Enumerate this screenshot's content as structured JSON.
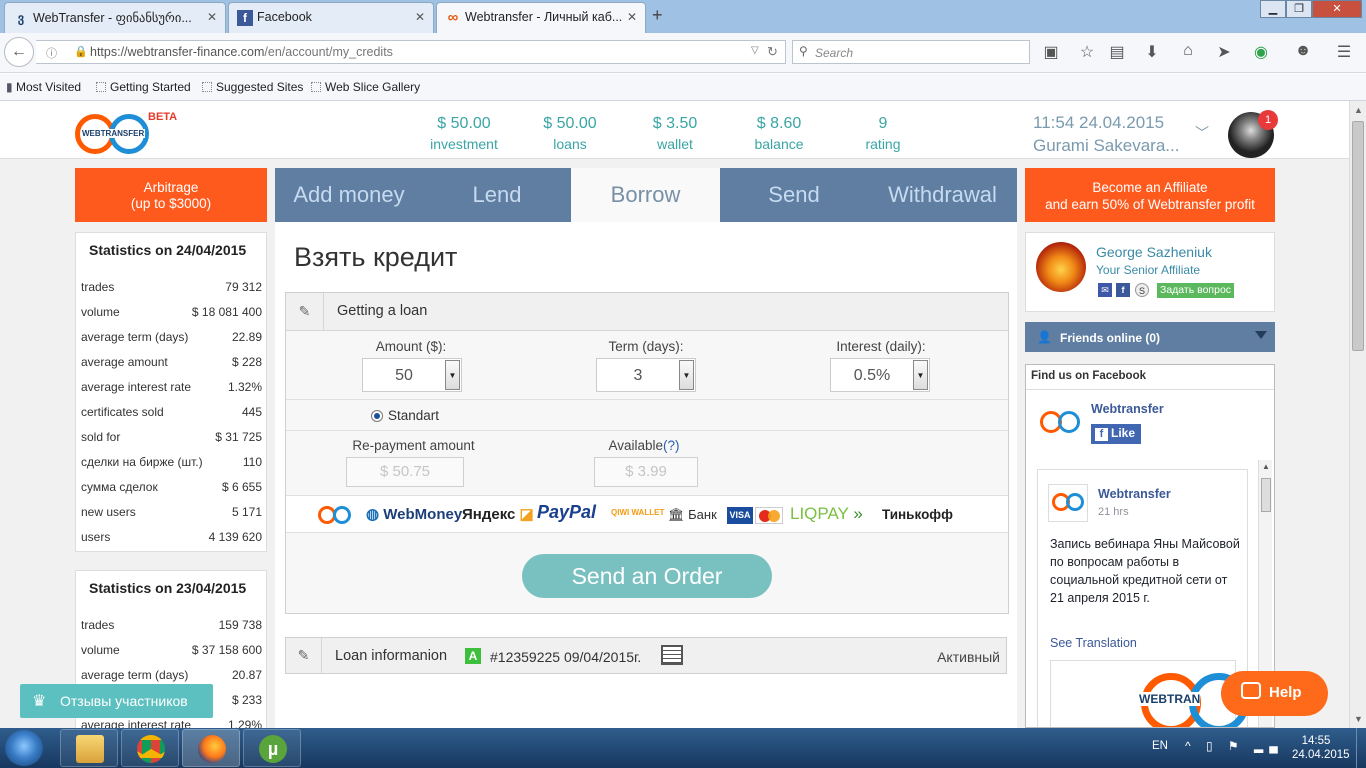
{
  "browser": {
    "tabs": [
      {
        "title": "WebTransfer - ფინანსური...",
        "favicon": "georgian-letter-icon",
        "fav_glyph": "ვ"
      },
      {
        "title": "Facebook",
        "favicon": "facebook-icon",
        "fav_glyph": "f"
      },
      {
        "title": "Webtransfer - Личный каб...",
        "favicon": "webtransfer-icon",
        "fav_glyph": "∞"
      }
    ],
    "close_glyph": "✕",
    "new_tab_glyph": "+",
    "url_domain": "https://webtransfer-finance.com",
    "url_path": "/en/account/my_credits",
    "search_placeholder": "Search",
    "bookmarks": [
      "Most Visited",
      "Getting Started",
      "Suggested Sites",
      "Web Slice Gallery"
    ]
  },
  "header": {
    "logo_text": "WEBTRANSFER",
    "beta": "BETA",
    "stats": [
      {
        "value": "$ 50.00",
        "label": "investment"
      },
      {
        "value": "$ 50.00",
        "label": "loans"
      },
      {
        "value": "$ 3.50",
        "label": "wallet"
      },
      {
        "value": "$ 8.60",
        "label": "balance"
      },
      {
        "value": "9",
        "label": "rating"
      }
    ],
    "datetime": "11:54 24.04.2015",
    "username": "Gurami Sakevara...",
    "notifications": "1"
  },
  "arbitrage": {
    "line1": "Arbitrage",
    "line2": "(up to $3000)"
  },
  "affiliate_promo": {
    "line1": "Become an Affiliate",
    "line2": "and earn 50% of Webtransfer profit"
  },
  "tabs": [
    "Add money",
    "Lend",
    "Borrow",
    "Send",
    "Withdrawal"
  ],
  "active_tab": "Borrow",
  "stats_today": {
    "title": "Statistics on 24/04/2015",
    "rows": [
      {
        "k": "trades",
        "v": "79 312"
      },
      {
        "k": "volume",
        "v": "$ 18 081 400"
      },
      {
        "k": "average term (days)",
        "v": "22.89"
      },
      {
        "k": "average amount",
        "v": "$ 228"
      },
      {
        "k": "average interest rate",
        "v": "1.32%"
      },
      {
        "k": "certificates sold",
        "v": "445"
      },
      {
        "k": "sold for",
        "v": "$ 31 725"
      },
      {
        "k": "сделки на бирже (шт.)",
        "v": "110"
      },
      {
        "k": "сумма сделок",
        "v": "$ 6 655"
      },
      {
        "k": "new users",
        "v": "5 171"
      },
      {
        "k": "users",
        "v": "4 139 620"
      }
    ]
  },
  "stats_yesterday": {
    "title": "Statistics on 23/04/2015",
    "rows": [
      {
        "k": "trades",
        "v": "159 738"
      },
      {
        "k": "volume",
        "v": "$ 37 158 600"
      },
      {
        "k": "average term (days)",
        "v": "20.87"
      },
      {
        "k": "average amount",
        "v": "$ 233"
      },
      {
        "k": "average interest rate",
        "v": "1.29%"
      }
    ]
  },
  "main": {
    "title": "Взять кредит",
    "panel_title": "Getting a loan",
    "amount_label": "Amount ($):",
    "amount_value": "50",
    "term_label": "Term (days):",
    "term_value": "3",
    "interest_label": "Interest (daily):",
    "interest_value": "0.5%",
    "radio_label": "Standart",
    "repayment_label": "Re-payment amount",
    "repayment_value": "$ 50.75",
    "available_label": "Available",
    "available_help": "(?)",
    "available_value": "$ 3.99",
    "payment_methods": [
      "WebMoney",
      "Яндекс",
      "PayPal",
      "QIWI WALLET",
      "Банк",
      "VISA",
      "LIQPAY",
      "Тинькофф"
    ],
    "send_button": "Send an Order",
    "info_title": "Loan informanion",
    "info_badge": "A",
    "info_id": "#12359225 09/04/2015г.",
    "info_status": "Активный"
  },
  "sidebar": {
    "affiliate_name": "George Sazheniuk",
    "affiliate_role": "Your Senior Affiliate",
    "ask_button": "Задать вопрос",
    "friends": "Friends online (0)",
    "fb_title": "Find us on Facebook",
    "fb_page": "Webtransfer",
    "fb_like": "Like",
    "fb_post_author": "Webtransfer",
    "fb_post_time": "21 hrs",
    "fb_post_text": "Запись вебинара Яны Майсовой по вопросам работы в социальной кредитной сети от 21 апреля 2015 г.",
    "fb_see_translation": "See Translation",
    "fb_image_text": "WEBTRAN"
  },
  "floating": {
    "reviews": "Отзывы участников",
    "help": "Help"
  },
  "taskbar": {
    "lang": "EN",
    "time": "14:55",
    "date": "24.04.2015"
  }
}
